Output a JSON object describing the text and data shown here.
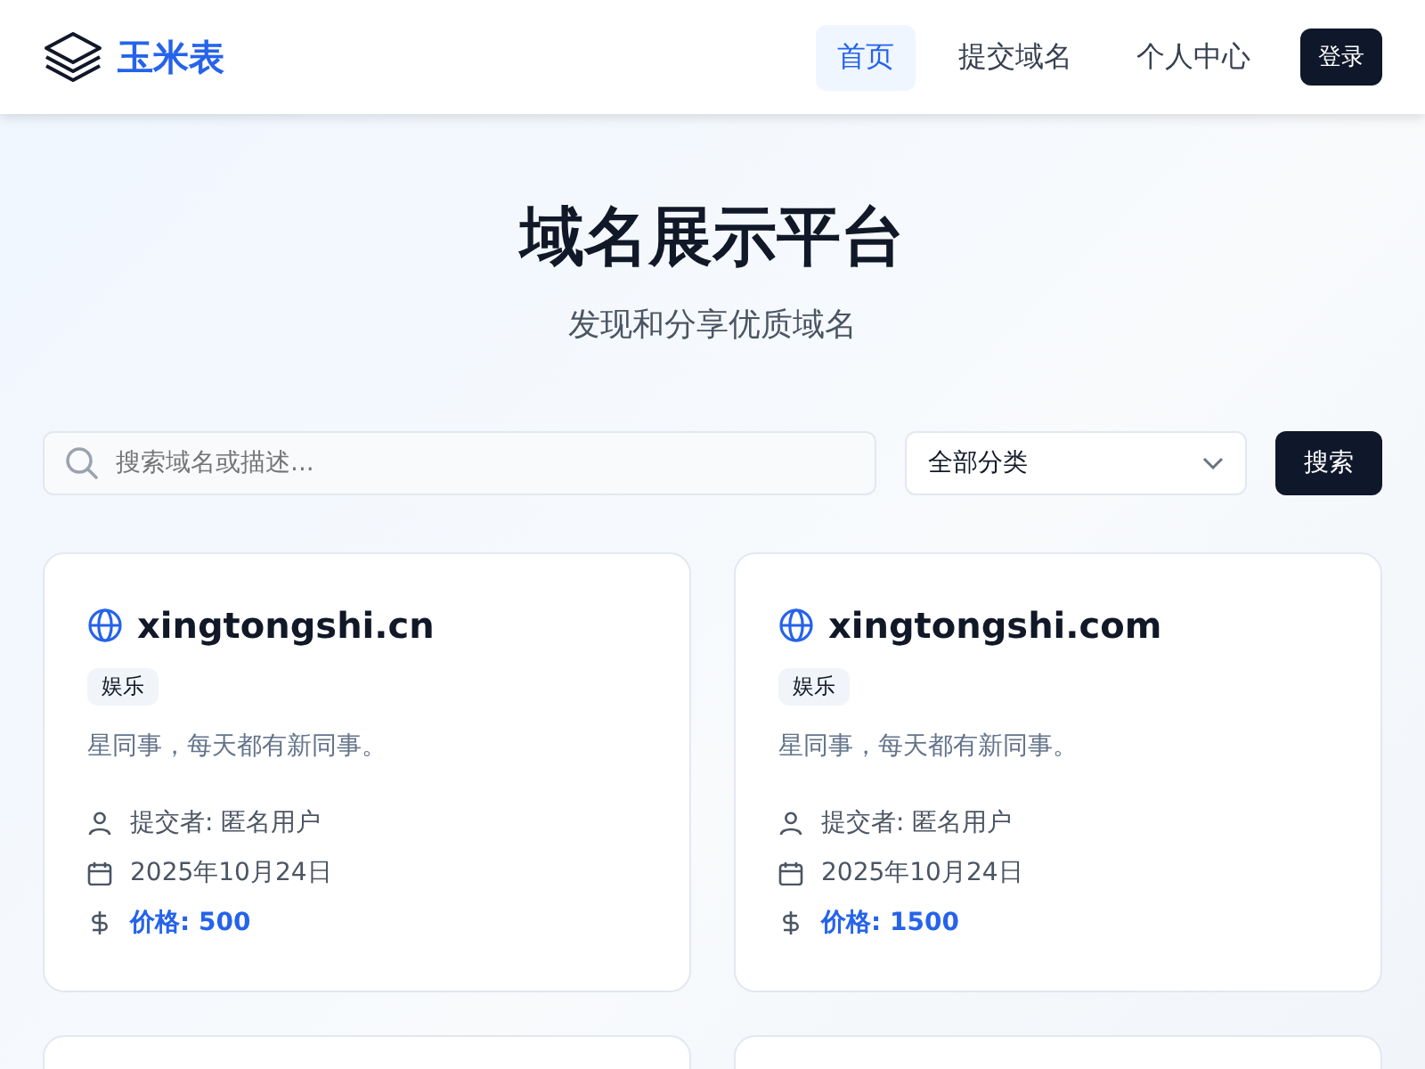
{
  "header": {
    "logo_text": "玉米表",
    "nav": [
      {
        "label": "首页",
        "selected": true
      },
      {
        "label": "提交域名",
        "selected": false
      },
      {
        "label": "个人中心",
        "selected": false
      }
    ],
    "login_button": "登录"
  },
  "hero": {
    "title": "域名展示平台",
    "subtitle": "发现和分享优质域名"
  },
  "search": {
    "placeholder": "搜索域名或描述...",
    "category": "全部分类",
    "button": "搜索"
  },
  "cards": [
    {
      "domain": "xingtongshi.cn",
      "tag": "娱乐",
      "description": "星同事，每天都有新同事。",
      "submitter": "提交者: 匿名用户",
      "date": "2025年10月24日",
      "price": "价格: 500"
    },
    {
      "domain": "xingtongshi.com",
      "tag": "娱乐",
      "description": "星同事，每天都有新同事。",
      "submitter": "提交者: 匿名用户",
      "date": "2025年10月24日",
      "price": "价格: 1500"
    }
  ]
}
